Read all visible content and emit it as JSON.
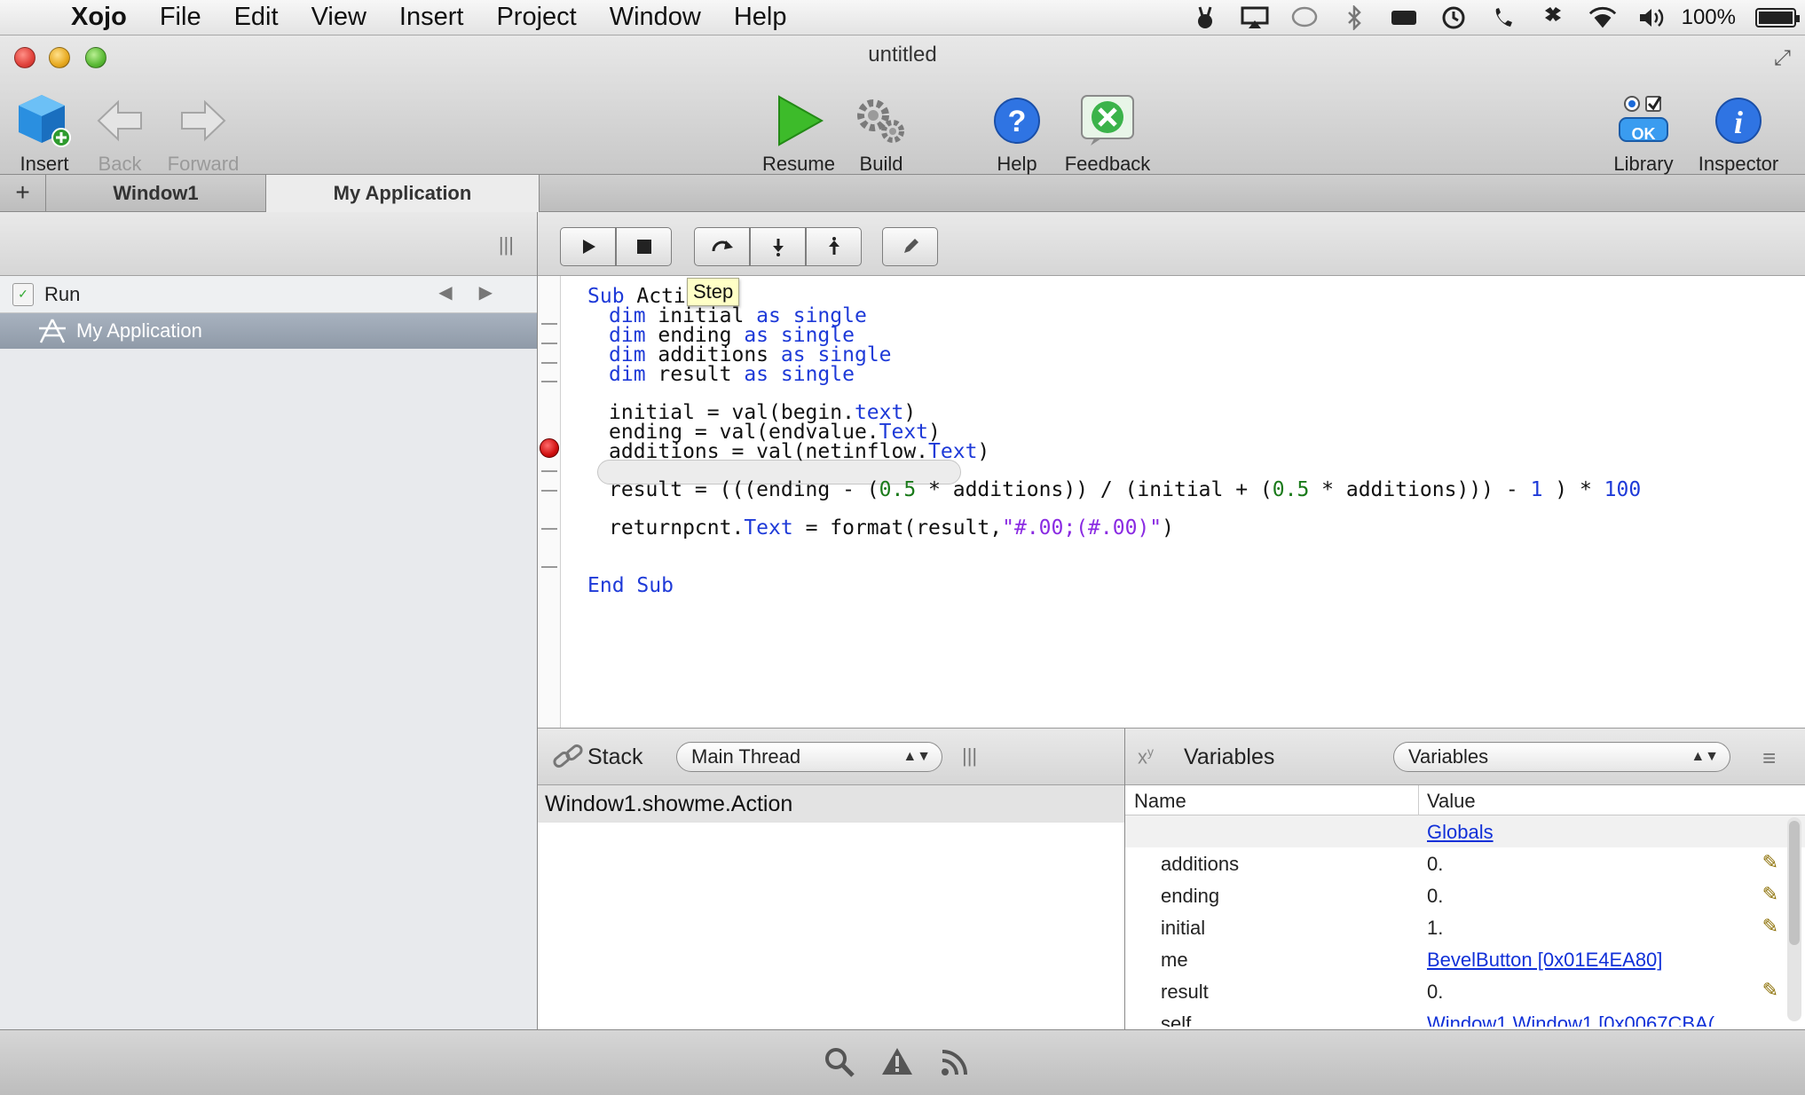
{
  "menubar": {
    "app_name": "Xojo",
    "items": [
      "File",
      "Edit",
      "View",
      "Insert",
      "Project",
      "Window",
      "Help"
    ],
    "battery_text": "100%",
    "battery_level": 1.0
  },
  "window": {
    "title": "untitled"
  },
  "toolbar": {
    "insert": "Insert",
    "back": "Back",
    "forward": "Forward",
    "resume": "Resume",
    "build": "Build",
    "help": "Help",
    "feedback": "Feedback",
    "library": "Library",
    "library_ok": "OK",
    "inspector": "Inspector"
  },
  "tabs": {
    "add": "+",
    "window1": "Window1",
    "my_application": "My Application"
  },
  "navigator": {
    "run_label": "Run",
    "app_label": "My Application"
  },
  "editor": {
    "tooltip": "Step",
    "code": {
      "l1_kw": "Sub",
      "l1_rest": " Acti",
      "dim": "dim",
      "as": "as",
      "single": "single",
      "v_initial": " initial ",
      "v_ending": " ending ",
      "v_additions": " additions ",
      "v_result": " result ",
      "l6_a": "initial = val(begin.",
      "l6_b": "text",
      "l6_c": ")",
      "l7_a": "ending = val(endvalue.",
      "l7_b": "Text",
      "l7_c": ")",
      "l8_a": "additions = val(netinflow.",
      "l8_b": "Text",
      "l8_c": ")",
      "l9_a": "result = (((ending - (",
      "l9_n1": "0.5",
      "l9_b": " * additions)) / (initial + (",
      "l9_n2": "0.5",
      "l9_c": " * additions))) - ",
      "l9_n3": "1",
      "l9_d": " ) * ",
      "l9_n4": "100",
      "l10_a": "returnpcnt.",
      "l10_b": "Text",
      "l10_c": " = format(result,",
      "l10_str": "\"#.00;(#.00)\"",
      "l10_d": ")",
      "end": "End Sub"
    }
  },
  "stack": {
    "title": "Stack",
    "thread_select": "Main Thread",
    "frames": [
      "Window1.showme.Action"
    ]
  },
  "variables": {
    "title": "Variables",
    "select": "Variables",
    "col_name": "Name",
    "col_value": "Value",
    "globals": "Globals",
    "rows": [
      {
        "name": "additions",
        "value": "0."
      },
      {
        "name": "ending",
        "value": "0."
      },
      {
        "name": "initial",
        "value": "1."
      },
      {
        "name": "me",
        "value": "BevelButton [0x01E4EA80]"
      },
      {
        "name": "result",
        "value": "0."
      },
      {
        "name": "self",
        "value": "Window1.Window1 [0x0067CBA("
      }
    ]
  }
}
